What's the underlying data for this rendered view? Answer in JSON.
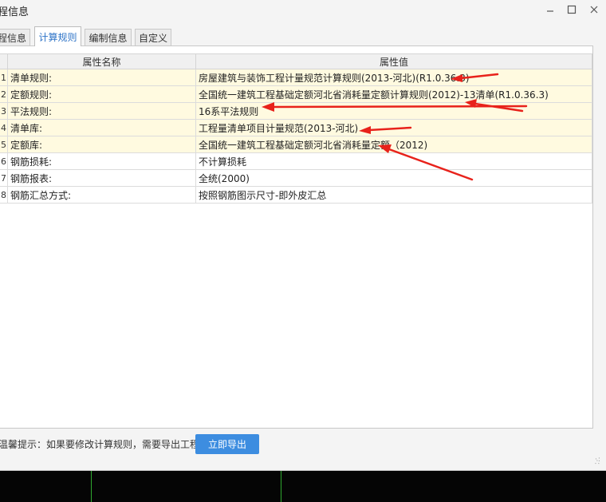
{
  "window": {
    "title": "程信息",
    "controls": [
      "minimize",
      "maximize",
      "close"
    ]
  },
  "tabs": [
    {
      "label": "程信息",
      "active": false
    },
    {
      "label": "计算规则",
      "active": true
    },
    {
      "label": "编制信息",
      "active": false
    },
    {
      "label": "自定义",
      "active": false
    }
  ],
  "table": {
    "columns": [
      "属性名称",
      "属性值"
    ],
    "rows": [
      {
        "num": "1",
        "name": "清单规则:",
        "value": "房屋建筑与装饰工程计量规范计算规则(2013-河北)(R1.0.36.3)",
        "highlighted": true
      },
      {
        "num": "2",
        "name": "定额规则:",
        "value": "全国统一建筑工程基础定额河北省消耗量定额计算规则(2012)-13清单(R1.0.36.3)",
        "highlighted": true
      },
      {
        "num": "3",
        "name": "平法规则:",
        "value": "16系平法规则",
        "highlighted": true
      },
      {
        "num": "4",
        "name": "清单库:",
        "value": "工程量清单项目计量规范(2013-河北)",
        "highlighted": true
      },
      {
        "num": "5",
        "name": "定额库:",
        "value": "全国统一建筑工程基础定额河北省消耗量定额（2012)",
        "highlighted": true
      },
      {
        "num": "6",
        "name": "钢筋损耗:",
        "value": "不计算损耗",
        "highlighted": false
      },
      {
        "num": "7",
        "name": "钢筋报表:",
        "value": "全统(2000)",
        "highlighted": false
      },
      {
        "num": "8",
        "name": "钢筋汇总方式:",
        "value": "按照钢筋图示尺寸-即外皮汇总",
        "highlighted": false
      }
    ]
  },
  "footer": {
    "hint": "温馨提示：如果要修改计算规则，需要导出工程",
    "export_label": "立即导出"
  },
  "colors": {
    "highlight_row": "#fffae0",
    "active_tab_text": "#2d73c7",
    "export_button": "#3d8de0",
    "annotation_arrow": "#e8221b"
  }
}
